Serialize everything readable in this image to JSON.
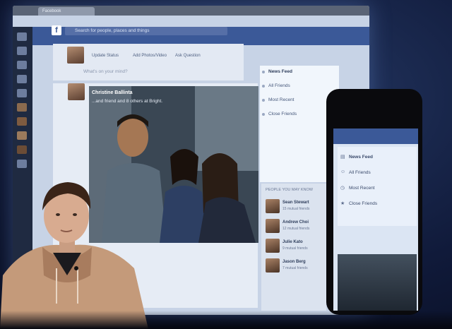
{
  "browser": {
    "tab_label": "Facebook"
  },
  "facebook": {
    "search_placeholder": "Search for people, places and things",
    "composer_actions": [
      "Update Status",
      "Add Photos/Video",
      "Ask Question"
    ],
    "composer_placeholder": "What's on your mind?",
    "post": {
      "author": "Christine Ballinta",
      "caption": "...and friend and 8 others at Bright."
    },
    "nav_menu": [
      "News Feed",
      "All Friends",
      "Most Recent",
      "Close Friends"
    ],
    "people_title": "PEOPLE YOU MAY KNOW",
    "people": [
      {
        "name": "Sean Stewart",
        "sub": "15 mutual friends"
      },
      {
        "name": "Andrew Choi",
        "sub": "12 mutual friends"
      },
      {
        "name": "Julie Kato",
        "sub": "9 mutual friends"
      },
      {
        "name": "Jason Berg",
        "sub": "7 mutual friends"
      }
    ]
  },
  "phone": {
    "menu": [
      "News Feed",
      "All Friends",
      "Most Recent",
      "Close Friends"
    ]
  },
  "colors": {
    "facebook_blue": "#3b5998",
    "stage_background": "#0c1530",
    "speaker_hoodie": "#c49a7a"
  }
}
